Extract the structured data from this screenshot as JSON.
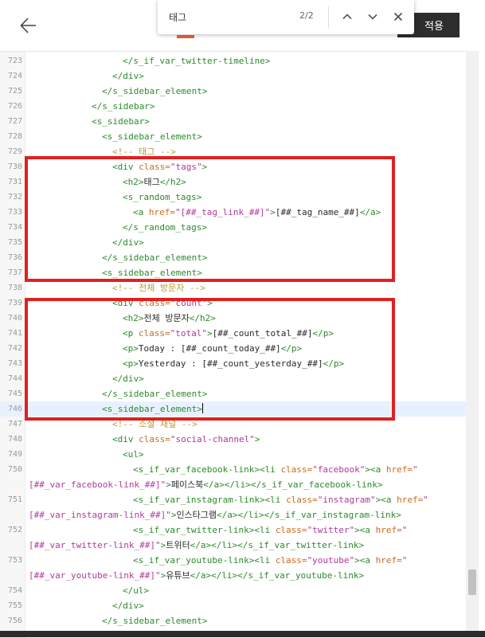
{
  "header": {
    "back_label": "back",
    "apply_label": "적용"
  },
  "find": {
    "query": "태그",
    "placeholder": "",
    "count": "2/2"
  },
  "colors": {
    "tag": "#2b8a2b",
    "attr": "#cc6a1e",
    "string": "#b03a9a",
    "comment": "#b59a3a",
    "highlight": "#e02020",
    "accent": "#e8623d"
  },
  "lines": [
    {
      "n": "723",
      "indent": 10,
      "toks": [
        [
          "t",
          "</s_if_var_twitter-timeline>"
        ]
      ]
    },
    {
      "n": "724",
      "indent": 9,
      "toks": [
        [
          "t",
          "</div>"
        ]
      ]
    },
    {
      "n": "725",
      "indent": 8,
      "toks": [
        [
          "t",
          "</s_sidebar_element>"
        ]
      ]
    },
    {
      "n": "726",
      "indent": 7,
      "toks": [
        [
          "t",
          "</s_sidebar>"
        ]
      ]
    },
    {
      "n": "727",
      "indent": 7,
      "toks": [
        [
          "t",
          "<s_sidebar>"
        ]
      ]
    },
    {
      "n": "728",
      "indent": 8,
      "toks": [
        [
          "t",
          "<s_sidebar_element>"
        ]
      ]
    },
    {
      "n": "729",
      "indent": 9,
      "toks": [
        [
          "c",
          "<!-- 태그 -->"
        ]
      ]
    },
    {
      "n": "730",
      "indent": 9,
      "toks": [
        [
          "t",
          "<div "
        ],
        [
          "a",
          "class="
        ],
        [
          "s",
          "\"tags\""
        ],
        [
          "t",
          ">"
        ]
      ]
    },
    {
      "n": "731",
      "indent": 10,
      "toks": [
        [
          "t",
          "<h2>"
        ],
        [
          "x",
          "태그"
        ],
        [
          "t",
          "</h2>"
        ]
      ]
    },
    {
      "n": "732",
      "indent": 10,
      "toks": [
        [
          "t",
          "<s_random_tags>"
        ]
      ]
    },
    {
      "n": "733",
      "indent": 11,
      "toks": [
        [
          "t",
          "<a "
        ],
        [
          "a",
          "href="
        ],
        [
          "s",
          "\"[##_tag_link_##]\""
        ],
        [
          "t",
          ">"
        ],
        [
          "x",
          "[##_tag_name_##]"
        ],
        [
          "t",
          "</a>"
        ]
      ]
    },
    {
      "n": "734",
      "indent": 10,
      "toks": [
        [
          "t",
          "</s_random_tags>"
        ]
      ]
    },
    {
      "n": "735",
      "indent": 9,
      "toks": [
        [
          "t",
          "</div>"
        ]
      ]
    },
    {
      "n": "736",
      "indent": 8,
      "toks": [
        [
          "t",
          "</s_sidebar_element>"
        ]
      ]
    },
    {
      "n": "737",
      "indent": 8,
      "toks": [
        [
          "t",
          "<s_sidebar_element>"
        ]
      ]
    },
    {
      "n": "738",
      "indent": 9,
      "toks": [
        [
          "c",
          "<!-- 전체 방문자 -->"
        ]
      ]
    },
    {
      "n": "739",
      "indent": 9,
      "toks": [
        [
          "t",
          "<div "
        ],
        [
          "a",
          "class="
        ],
        [
          "s",
          "\"count\""
        ],
        [
          "t",
          ">"
        ]
      ]
    },
    {
      "n": "740",
      "indent": 10,
      "toks": [
        [
          "t",
          "<h2>"
        ],
        [
          "x",
          "전체 방문자"
        ],
        [
          "t",
          "</h2>"
        ]
      ]
    },
    {
      "n": "741",
      "indent": 10,
      "toks": [
        [
          "t",
          "<p "
        ],
        [
          "a",
          "class="
        ],
        [
          "s",
          "\"total\""
        ],
        [
          "t",
          ">"
        ],
        [
          "x",
          "[##_count_total_##]"
        ],
        [
          "t",
          "</p>"
        ]
      ]
    },
    {
      "n": "742",
      "indent": 10,
      "toks": [
        [
          "t",
          "<p>"
        ],
        [
          "x",
          "Today : [##_count_today_##]"
        ],
        [
          "t",
          "</p>"
        ]
      ]
    },
    {
      "n": "743",
      "indent": 10,
      "toks": [
        [
          "t",
          "<p>"
        ],
        [
          "x",
          "Yesterday : [##_count_yesterday_##]"
        ],
        [
          "t",
          "</p>"
        ]
      ]
    },
    {
      "n": "744",
      "indent": 9,
      "toks": [
        [
          "t",
          "</div>"
        ]
      ]
    },
    {
      "n": "745",
      "indent": 8,
      "toks": [
        [
          "t",
          "</s_sidebar_element>"
        ]
      ]
    },
    {
      "n": "746",
      "indent": 8,
      "toks": [
        [
          "t",
          "<s_sidebar_element>"
        ]
      ],
      "active": true
    },
    {
      "n": "747",
      "indent": 9,
      "toks": [
        [
          "c",
          "<!-- 소셜 채널 -->"
        ]
      ]
    },
    {
      "n": "748",
      "indent": 9,
      "toks": [
        [
          "t",
          "<div "
        ],
        [
          "a",
          "class="
        ],
        [
          "s",
          "\"social-channel\""
        ],
        [
          "t",
          ">"
        ]
      ]
    },
    {
      "n": "749",
      "indent": 10,
      "toks": [
        [
          "t",
          "<ul>"
        ]
      ]
    },
    {
      "n": "750",
      "indent": 11,
      "toks": [
        [
          "t",
          "<s_if_var_facebook-link><li "
        ],
        [
          "a",
          "class="
        ],
        [
          "s",
          "\"facebook\""
        ],
        [
          "t",
          ">"
        ],
        [
          "t",
          "<a "
        ],
        [
          "a",
          "href="
        ],
        [
          "s",
          "\""
        ]
      ]
    },
    {
      "n": "",
      "wrap": true,
      "toks": [
        [
          "s",
          "[##_var_facebook-link_##]\""
        ],
        [
          "t",
          ">"
        ],
        [
          "x",
          "페이스북"
        ],
        [
          "t",
          "</a></li></s_if_var_facebook-link>"
        ]
      ]
    },
    {
      "n": "751",
      "indent": 11,
      "toks": [
        [
          "t",
          "<s_if_var_instagram-link><li "
        ],
        [
          "a",
          "class="
        ],
        [
          "s",
          "\"instagram\""
        ],
        [
          "t",
          ">"
        ],
        [
          "t",
          "<a "
        ],
        [
          "a",
          "href="
        ],
        [
          "s",
          "\""
        ]
      ]
    },
    {
      "n": "",
      "wrap": true,
      "toks": [
        [
          "s",
          "[##_var_instagram-link_##]\""
        ],
        [
          "t",
          ">"
        ],
        [
          "x",
          "인스타그램"
        ],
        [
          "t",
          "</a></li></s_if_var_instagram-link>"
        ]
      ]
    },
    {
      "n": "752",
      "indent": 11,
      "toks": [
        [
          "t",
          "<s_if_var_twitter-link><li "
        ],
        [
          "a",
          "class="
        ],
        [
          "s",
          "\"twitter\""
        ],
        [
          "t",
          ">"
        ],
        [
          "t",
          "<a "
        ],
        [
          "a",
          "href="
        ],
        [
          "s",
          "\""
        ]
      ]
    },
    {
      "n": "",
      "wrap": true,
      "toks": [
        [
          "s",
          "[##_var_twitter-link_##]\""
        ],
        [
          "t",
          ">"
        ],
        [
          "x",
          "트위터"
        ],
        [
          "t",
          "</a></li></s_if_var_twitter-link>"
        ]
      ]
    },
    {
      "n": "753",
      "indent": 11,
      "toks": [
        [
          "t",
          "<s_if_var_youtube-link><li "
        ],
        [
          "a",
          "class="
        ],
        [
          "s",
          "\"youtube\""
        ],
        [
          "t",
          ">"
        ],
        [
          "t",
          "<a "
        ],
        [
          "a",
          "href="
        ],
        [
          "s",
          "\""
        ]
      ]
    },
    {
      "n": "",
      "wrap": true,
      "toks": [
        [
          "s",
          "[##_var_youtube-link_##]\""
        ],
        [
          "t",
          ">"
        ],
        [
          "x",
          "유튜브"
        ],
        [
          "t",
          "</a></li></s_if_var_youtube-link>"
        ]
      ]
    },
    {
      "n": "754",
      "indent": 10,
      "toks": [
        [
          "t",
          "</ul>"
        ]
      ]
    },
    {
      "n": "755",
      "indent": 9,
      "toks": [
        [
          "t",
          "</div>"
        ]
      ]
    },
    {
      "n": "756",
      "indent": 8,
      "toks": [
        [
          "t",
          "</s_sidebar_element>"
        ]
      ]
    }
  ]
}
